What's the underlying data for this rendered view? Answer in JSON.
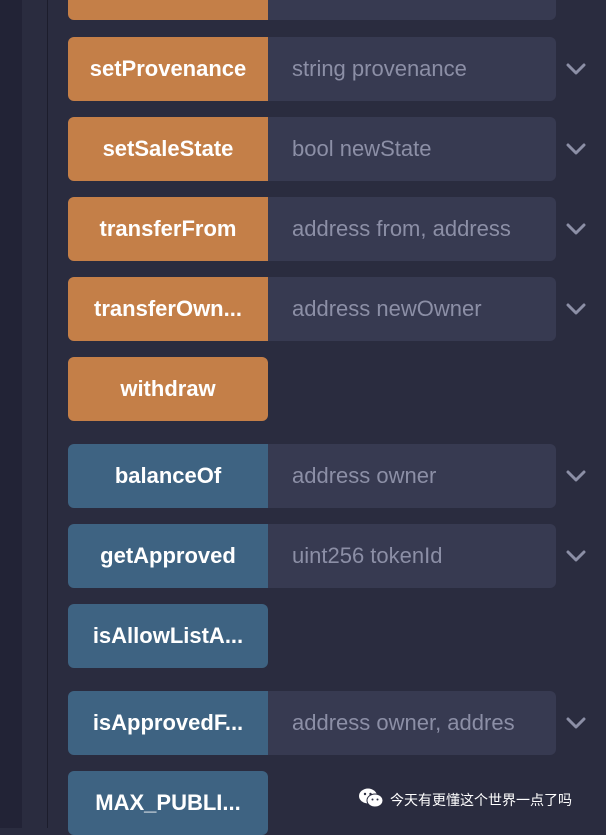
{
  "rows": [
    {
      "label": "",
      "param": "",
      "color": "orange"
    },
    {
      "label": "setProvenance",
      "param": "string provenance",
      "color": "orange"
    },
    {
      "label": "setSaleState",
      "param": "bool newState",
      "color": "orange"
    },
    {
      "label": "transferFrom",
      "param": "address from, address",
      "color": "orange"
    },
    {
      "label": "transferOwn...",
      "param": "address newOwner",
      "color": "orange"
    },
    {
      "label": "withdraw",
      "param": "",
      "color": "orange"
    },
    {
      "label": "balanceOf",
      "param": "address owner",
      "color": "blue"
    },
    {
      "label": "getApproved",
      "param": "uint256 tokenId",
      "color": "blue"
    },
    {
      "label": "isAllowListA...",
      "param": "",
      "color": "blue"
    },
    {
      "label": "isApprovedF...",
      "param": "address owner, addres",
      "color": "blue"
    },
    {
      "label": "MAX_PUBLI...",
      "param": "",
      "color": "blue"
    }
  ],
  "watermark": {
    "text": "今天有更懂这个世界一点了吗",
    "icon": "wechat-icon"
  },
  "colors": {
    "orange": "#c47f48",
    "blue": "#3e6382",
    "param_bg": "#373a51",
    "bg": "#2a2c3f"
  }
}
